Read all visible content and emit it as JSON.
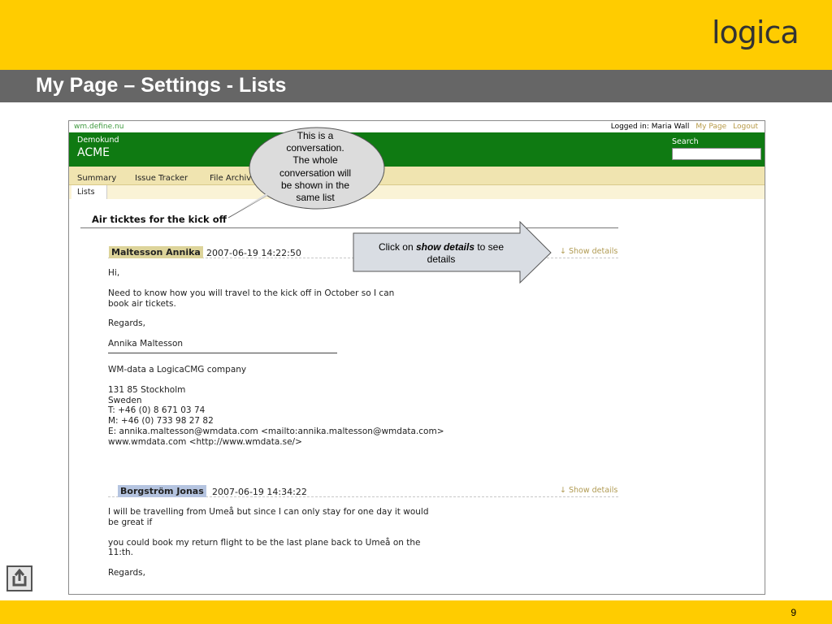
{
  "slide": {
    "title": "My Page – Settings - Lists",
    "logo_text": "logica",
    "page_number": "9",
    "colors": {
      "brand_yellow": "#ffcc00",
      "title_bar": "#666666",
      "site_green": "#0f7a12"
    },
    "back_icon": "return-arrow-icon"
  },
  "site": {
    "url": "wm.define.nu",
    "logged_in": "Logged in: Maria Wall",
    "my_page": "My Page",
    "logout": "Logout",
    "customer": "Demokund",
    "project": "ACME",
    "search_label": "Search",
    "search_value": ""
  },
  "tabs": {
    "summary": "Summary",
    "issue_tracker": "Issue Tracker",
    "file_archive": "File Archiv",
    "lists": "Lists"
  },
  "thread": {
    "title": "Air ticktes for the kick off",
    "show_details": "↓ Show details",
    "message1": {
      "author": "Maltesson Annika",
      "date": "2007-06-19 14:22:50",
      "greeting": "Hi,",
      "line1": "Need to know how you will travel to the kick off in October so I can",
      "line2": "book air tickets.",
      "regards": "Regards,",
      "signature_name": "Annika Maltesson",
      "company": "WM-data a LogicaCMG company",
      "address1": "131 85 Stockholm",
      "address2": "Sweden",
      "phone": "T:  +46 (0) 8 671 03 74",
      "mobile": "M: +46 (0) 733 98 27 82",
      "email": "E:  annika.maltesson@wmdata.com <mailto:annika.maltesson@wmdata.com>",
      "web": "www.wmdata.com <http://www.wmdata.se/>"
    },
    "message2": {
      "author": "Borgström Jonas",
      "date": "2007-06-19 14:34:22",
      "line1": "I will be travelling from Umeå but since I can only stay for one day it would",
      "line2": "be great if",
      "line3": "you could book my return flight to be the last plane back to Umeå on the",
      "line4": "11:th.",
      "regards": "Regards,"
    }
  },
  "callouts": {
    "bubble_lines": [
      "This is a",
      "conversation.",
      "The whole",
      "conversation will",
      "be shown in the",
      "same list"
    ],
    "arrow_prefix": "Click on ",
    "arrow_emph": "show details",
    "arrow_suffix": " to see",
    "arrow_line2": "details"
  }
}
